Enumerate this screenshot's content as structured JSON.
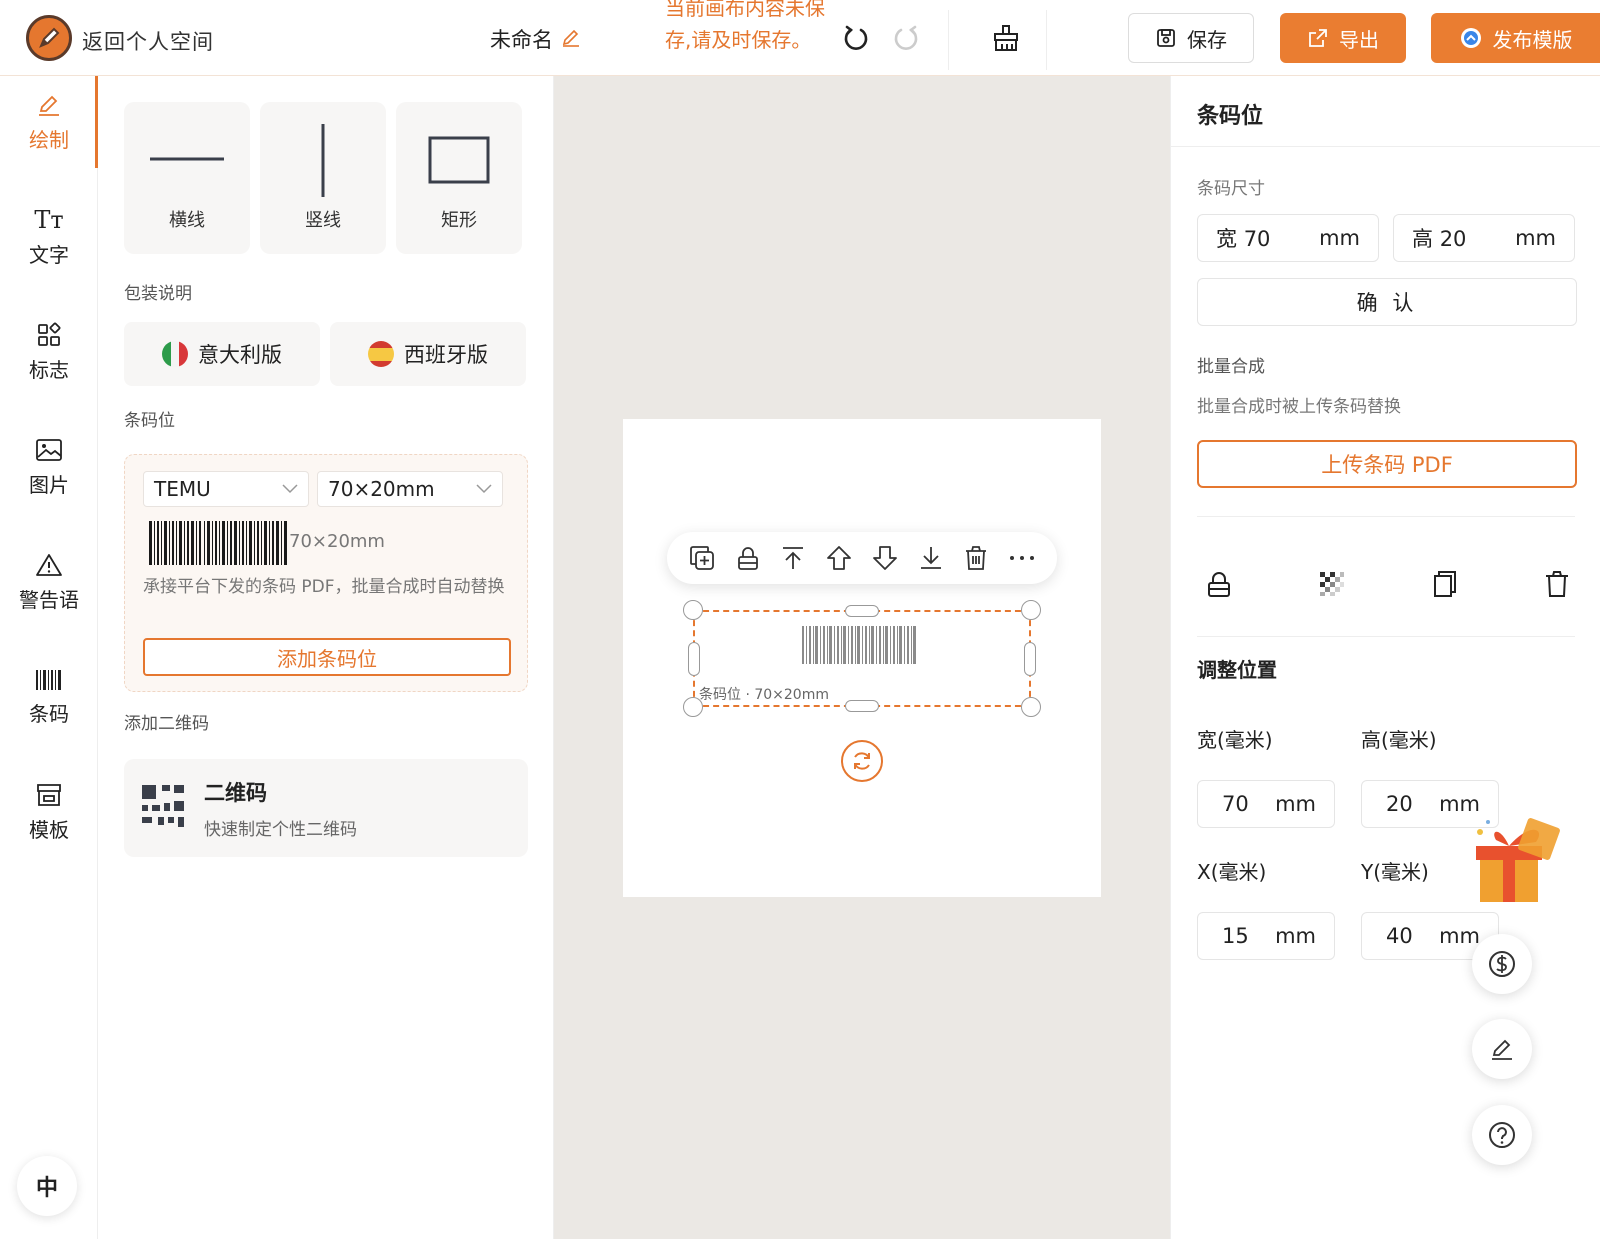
{
  "header": {
    "back_label": "返回个人空间",
    "doc_name": "未命名",
    "unsaved_notice": "当前画布内容未保存,请及时保存。",
    "save_label": "保存",
    "export_label": "导出",
    "publish_label": "发布模版",
    "icons": [
      "undo-icon",
      "redo-icon",
      "clear-brush-icon",
      "save-icon",
      "export-icon",
      "publish-icon"
    ]
  },
  "rail": {
    "items": [
      {
        "label": "绘制",
        "icon": "pencil-icon",
        "active": true
      },
      {
        "label": "文字",
        "icon": "text-icon"
      },
      {
        "label": "标志",
        "icon": "grid-icon"
      },
      {
        "label": "图片",
        "icon": "image-icon"
      },
      {
        "label": "警告语",
        "icon": "warning-icon"
      },
      {
        "label": "条码",
        "icon": "barcode-icon"
      },
      {
        "label": "模板",
        "icon": "template-icon"
      }
    ],
    "language": "中"
  },
  "panel": {
    "shapes": [
      {
        "label": "横线"
      },
      {
        "label": "竖线"
      },
      {
        "label": "矩形"
      }
    ],
    "packaging_title": "包装说明",
    "packaging": [
      {
        "label": "意大利版"
      },
      {
        "label": "西班牙版"
      }
    ],
    "barcode_title": "条码位",
    "barcode": {
      "platform": "TEMU",
      "size_option": "70×20mm",
      "size_caption": "70×20mm",
      "description": "承接平台下发的条码 PDF，批量合成时自动替换",
      "add_label": "添加条码位"
    },
    "qr_title": "添加二维码",
    "qr": {
      "title": "二维码",
      "subtitle": "快速制定个性二维码"
    }
  },
  "canvas": {
    "selection_label": "条码位 · 70×20mm",
    "toolbar_icons": [
      "copy-add-icon",
      "lock-icon",
      "bring-to-front-icon",
      "bring-forward-icon",
      "send-backward-icon",
      "send-to-back-icon",
      "delete-icon",
      "more-icon"
    ]
  },
  "right_panel": {
    "title": "条码位",
    "size_title": "条码尺寸",
    "width_prefix": "宽",
    "width": "70",
    "height_prefix": "高",
    "height": "20",
    "unit": "mm",
    "confirm_label": "确 认",
    "batch_title": "批量合成",
    "batch_desc": "批量合成时被上传条码替换",
    "upload_label": "上传条码 PDF",
    "action_icons": [
      "lock-icon",
      "transparency-icon",
      "duplicate-icon",
      "delete-icon"
    ],
    "position_title": "调整位置",
    "pos": {
      "w_label": "宽(毫米)",
      "w_value": "70",
      "h_label": "高(毫米)",
      "h_value": "20",
      "x_label": "X(毫米)",
      "x_value": "15",
      "y_label": "Y(毫米)",
      "y_value": "40",
      "unit": "mm"
    }
  },
  "floating": [
    "dollar-icon",
    "edit-icon",
    "help-icon"
  ],
  "colors": {
    "accent": "#ea7d31",
    "canvas_bg": "#ebe8e4",
    "card_bg": "#f7f6f5"
  }
}
